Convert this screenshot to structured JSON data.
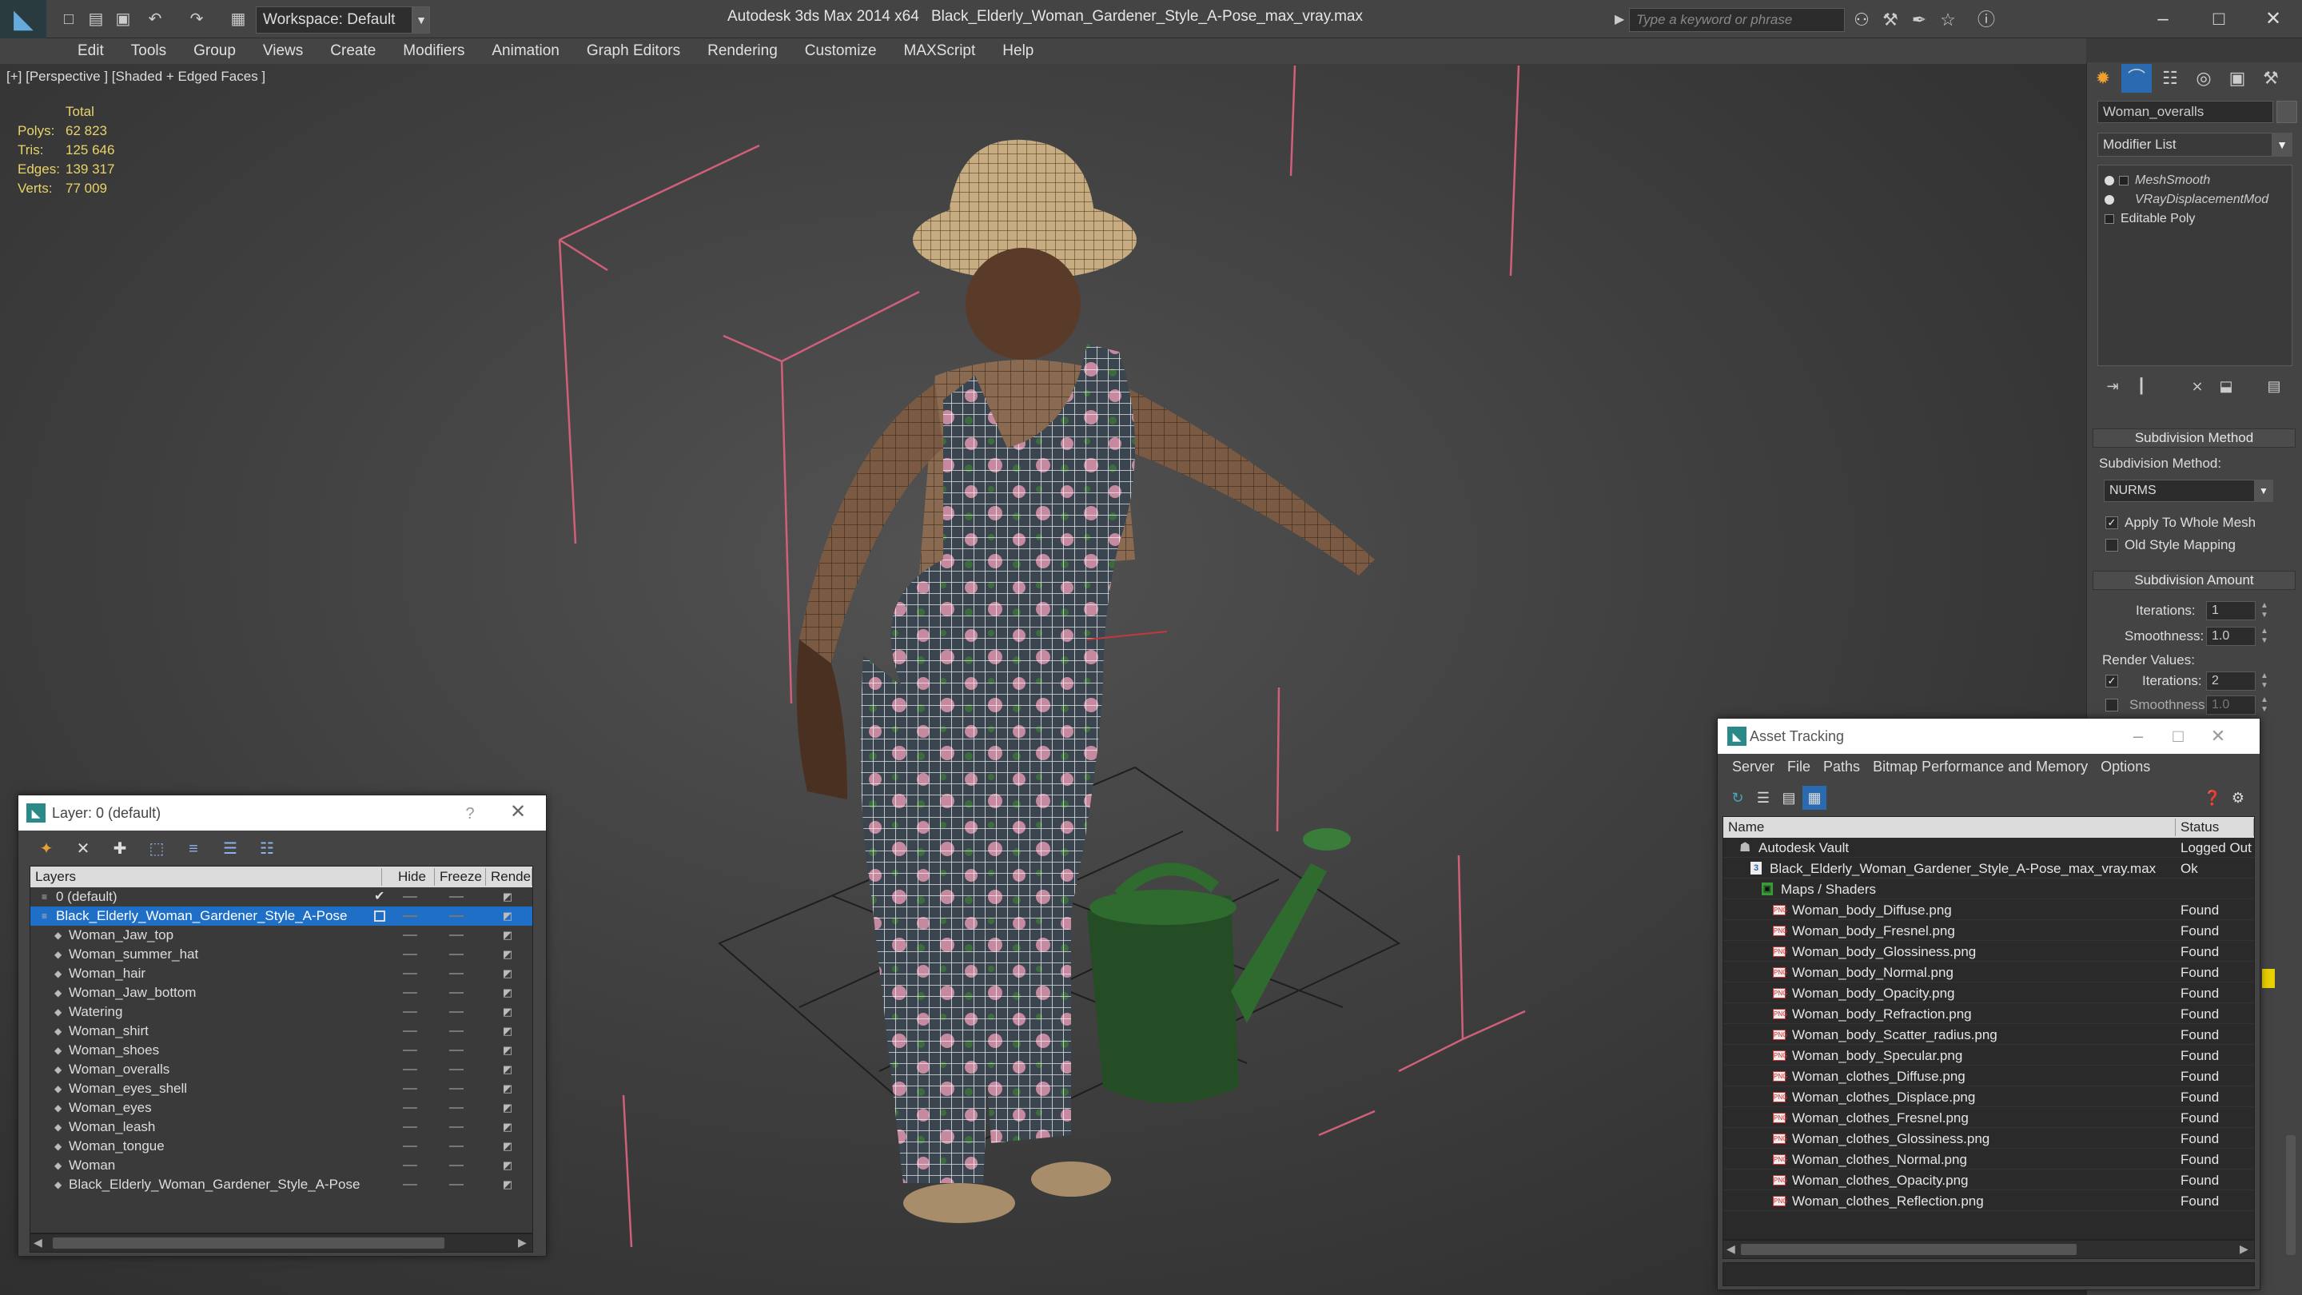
{
  "titlebar": {
    "workspace": "Workspace: Default",
    "app_title": "Autodesk 3ds Max 2014 x64",
    "file_title": "Black_Elderly_Woman_Gardener_Style_A-Pose_max_vray.max",
    "search_placeholder": "Type a keyword or phrase",
    "minimize": "–",
    "maximize": "□",
    "close": "✕"
  },
  "menu": [
    "Edit",
    "Tools",
    "Group",
    "Views",
    "Create",
    "Modifiers",
    "Animation",
    "Graph Editors",
    "Rendering",
    "Customize",
    "MAXScript",
    "Help"
  ],
  "viewport": {
    "label": "[+] [Perspective ] [Shaded + Edged Faces ]",
    "stats": {
      "header": "Total",
      "polys_label": "Polys:",
      "polys": "62 823",
      "tris_label": "Tris:",
      "tris": "125 646",
      "edges_label": "Edges:",
      "edges": "139 317",
      "verts_label": "Verts:",
      "verts": "77 009"
    }
  },
  "command_panel": {
    "object_name": "Woman_overalls",
    "modifier_list": "Modifier List",
    "stack": [
      "MeshSmooth",
      "VRayDisplacementMod",
      "Editable Poly"
    ],
    "subdivision_method": {
      "title": "Subdivision Method",
      "label": "Subdivision Method:",
      "value": "NURMS",
      "apply_whole_mesh": "Apply To Whole Mesh",
      "old_style_mapping": "Old Style Mapping"
    },
    "subdivision_amount": {
      "title": "Subdivision Amount",
      "iterations_label": "Iterations:",
      "iterations": "1",
      "smoothness_label": "Smoothness:",
      "smoothness": "1.0",
      "render_values": "Render Values:",
      "render_iterations": "2",
      "render_smoothness": "1.0"
    },
    "colors": {
      "accent": "#1e6fc5"
    }
  },
  "layer_window": {
    "title": "Layer: 0 (default)",
    "help": "?",
    "close": "✕",
    "columns": [
      "Layers",
      "Hide",
      "Freeze",
      "Rende"
    ],
    "rows": [
      {
        "name": "0 (default)",
        "level": 0,
        "check": "✔"
      },
      {
        "name": "Black_Elderly_Woman_Gardener_Style_A-Pose",
        "level": 0,
        "selected": true
      },
      {
        "name": "Woman_Jaw_top",
        "level": 1
      },
      {
        "name": "Woman_summer_hat",
        "level": 1
      },
      {
        "name": "Woman_hair",
        "level": 1
      },
      {
        "name": "Woman_Jaw_bottom",
        "level": 1
      },
      {
        "name": "Watering",
        "level": 1
      },
      {
        "name": "Woman_shirt",
        "level": 1
      },
      {
        "name": "Woman_shoes",
        "level": 1
      },
      {
        "name": "Woman_overalls",
        "level": 1
      },
      {
        "name": "Woman_eyes_shell",
        "level": 1
      },
      {
        "name": "Woman_eyes",
        "level": 1
      },
      {
        "name": "Woman_leash",
        "level": 1
      },
      {
        "name": "Woman_tongue",
        "level": 1
      },
      {
        "name": "Woman",
        "level": 1
      },
      {
        "name": "Black_Elderly_Woman_Gardener_Style_A-Pose",
        "level": 1
      }
    ]
  },
  "asset_window": {
    "title": "Asset Tracking",
    "menu": [
      "Server",
      "File",
      "Paths",
      "Bitmap Performance and Memory",
      "Options"
    ],
    "columns": [
      "Name",
      "Status"
    ],
    "rows": [
      {
        "name": "Autodesk Vault",
        "status": "Logged Out",
        "level": 0,
        "type": "vault"
      },
      {
        "name": "Black_Elderly_Woman_Gardener_Style_A-Pose_max_vray.max",
        "status": "Ok",
        "level": 1,
        "type": "max"
      },
      {
        "name": "Maps / Shaders",
        "status": "",
        "level": 2,
        "type": "folder"
      },
      {
        "name": "Woman_body_Diffuse.png",
        "status": "Found",
        "level": 3,
        "type": "png"
      },
      {
        "name": "Woman_body_Fresnel.png",
        "status": "Found",
        "level": 3,
        "type": "png"
      },
      {
        "name": "Woman_body_Glossiness.png",
        "status": "Found",
        "level": 3,
        "type": "png"
      },
      {
        "name": "Woman_body_Normal.png",
        "status": "Found",
        "level": 3,
        "type": "png"
      },
      {
        "name": "Woman_body_Opacity.png",
        "status": "Found",
        "level": 3,
        "type": "png"
      },
      {
        "name": "Woman_body_Refraction.png",
        "status": "Found",
        "level": 3,
        "type": "png"
      },
      {
        "name": "Woman_body_Scatter_radius.png",
        "status": "Found",
        "level": 3,
        "type": "png"
      },
      {
        "name": "Woman_body_Specular.png",
        "status": "Found",
        "level": 3,
        "type": "png"
      },
      {
        "name": "Woman_clothes_Diffuse.png",
        "status": "Found",
        "level": 3,
        "type": "png"
      },
      {
        "name": "Woman_clothes_Displace.png",
        "status": "Found",
        "level": 3,
        "type": "png"
      },
      {
        "name": "Woman_clothes_Fresnel.png",
        "status": "Found",
        "level": 3,
        "type": "png"
      },
      {
        "name": "Woman_clothes_Glossiness.png",
        "status": "Found",
        "level": 3,
        "type": "png"
      },
      {
        "name": "Woman_clothes_Normal.png",
        "status": "Found",
        "level": 3,
        "type": "png"
      },
      {
        "name": "Woman_clothes_Opacity.png",
        "status": "Found",
        "level": 3,
        "type": "png"
      },
      {
        "name": "Woman_clothes_Reflection.png",
        "status": "Found",
        "level": 3,
        "type": "png"
      }
    ]
  }
}
